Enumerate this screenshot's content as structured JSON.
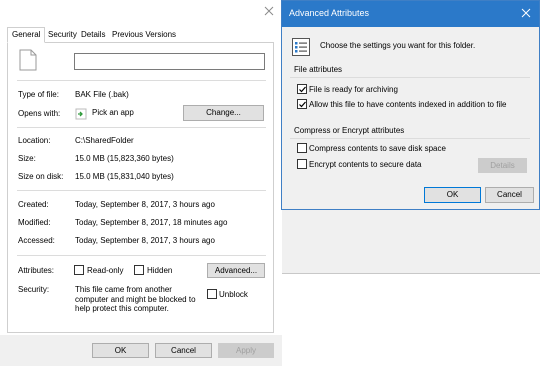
{
  "props": {
    "tabs": [
      {
        "label": "General",
        "active": true
      },
      {
        "label": "Security",
        "active": false
      },
      {
        "label": "Details",
        "active": false
      },
      {
        "label": "Previous Versions",
        "active": false
      }
    ],
    "file_name_value": "",
    "type_label": "Type of file:",
    "type_value": "BAK File (.bak)",
    "opens_label": "Opens with:",
    "opens_value": "Pick an app",
    "change_button": "Change...",
    "location_label": "Location:",
    "location_value": "C:\\SharedFolder",
    "size_label": "Size:",
    "size_value": "15.0 MB (15,823,360 bytes)",
    "size_on_disk_label": "Size on disk:",
    "size_on_disk_value": "15.0 MB (15,831,040 bytes)",
    "created_label": "Created:",
    "created_value": "Today, September 8, 2017, 3 hours ago",
    "modified_label": "Modified:",
    "modified_value": "Today, September 8, 2017, 18 minutes ago",
    "accessed_label": "Accessed:",
    "accessed_value": "Today, September 8, 2017, 3 hours ago",
    "attributes_label": "Attributes:",
    "readonly_label": "Read-only",
    "readonly_checked": false,
    "hidden_label": "Hidden",
    "hidden_checked": false,
    "advanced_button": "Advanced...",
    "security_label": "Security:",
    "security_text": "This file came from another computer and might be blocked to help protect this computer.",
    "unblock_label": "Unblock",
    "unblock_checked": false,
    "ok_button": "OK",
    "cancel_button": "Cancel",
    "apply_button": "Apply"
  },
  "adv": {
    "title": "Advanced Attributes",
    "description": "Choose the settings you want for this folder.",
    "file_attributes_title": "File attributes",
    "archive_label": "File is ready for archiving",
    "archive_checked": true,
    "index_label": "Allow this file to have contents indexed in addition to file",
    "index_checked": true,
    "compress_group_title": "Compress or Encrypt attributes",
    "compress_label": "Compress contents to save disk space",
    "compress_checked": false,
    "encrypt_label": "Encrypt contents to secure data",
    "encrypt_checked": false,
    "details_button": "Details",
    "ok_button": "OK",
    "cancel_button": "Cancel"
  },
  "colors": {
    "title_bar": "#2b79c9",
    "dialog_bg": "#f0f0f0",
    "button_bg": "#e1e1e1",
    "button_border": "#adadad",
    "ok_border": "#0078d7"
  }
}
